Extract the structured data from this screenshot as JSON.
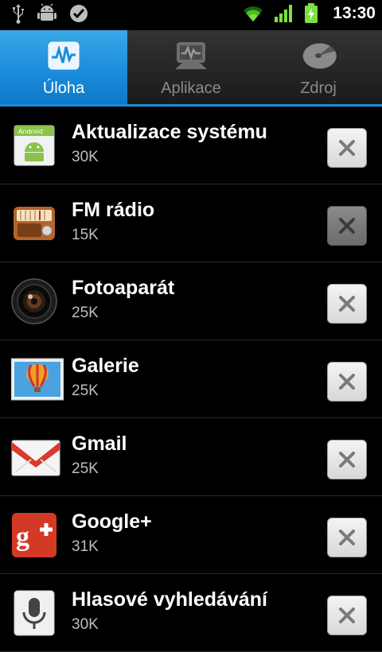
{
  "status_bar": {
    "time": "13:30",
    "left_icons": [
      "usb-icon",
      "android-debug-icon",
      "skype-icon"
    ],
    "right_icons": [
      "wifi-icon",
      "signal-icon",
      "battery-charging-icon"
    ]
  },
  "tabs": [
    {
      "label": "Úloha",
      "icon": "activity-monitor-icon",
      "active": true
    },
    {
      "label": "Aplikace",
      "icon": "apps-monitor-icon",
      "active": false
    },
    {
      "label": "Zdroj",
      "icon": "pie-chart-icon",
      "active": false
    }
  ],
  "tasks": [
    {
      "name": "Aktualizace systému",
      "size": "30K",
      "icon": "system-update-icon"
    },
    {
      "name": "FM rádio",
      "size": "15K",
      "icon": "fm-radio-icon"
    },
    {
      "name": "Fotoaparát",
      "size": "25K",
      "icon": "camera-icon"
    },
    {
      "name": "Galerie",
      "size": "25K",
      "icon": "gallery-icon"
    },
    {
      "name": "Gmail",
      "size": "25K",
      "icon": "gmail-icon"
    },
    {
      "name": "Google+",
      "size": "31K",
      "icon": "google-plus-icon"
    },
    {
      "name": "Hlasové vyhledávání",
      "size": "30K",
      "icon": "voice-search-icon"
    }
  ],
  "colors": {
    "accent": "#1d8ddb",
    "background": "#000000",
    "secondary_text": "#bdbdbd"
  }
}
